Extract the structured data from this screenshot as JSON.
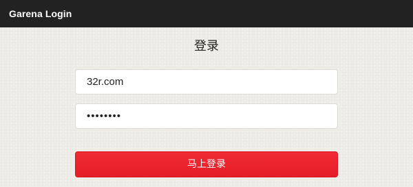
{
  "window": {
    "title": "Garena Login"
  },
  "page": {
    "title": "登录"
  },
  "form": {
    "username_value": "32r.com",
    "password_value": "********",
    "submit_label": "马上登录"
  },
  "colors": {
    "titlebar_bg": "#222222",
    "page_bg": "#efede7",
    "button_red": "#e8222c"
  }
}
